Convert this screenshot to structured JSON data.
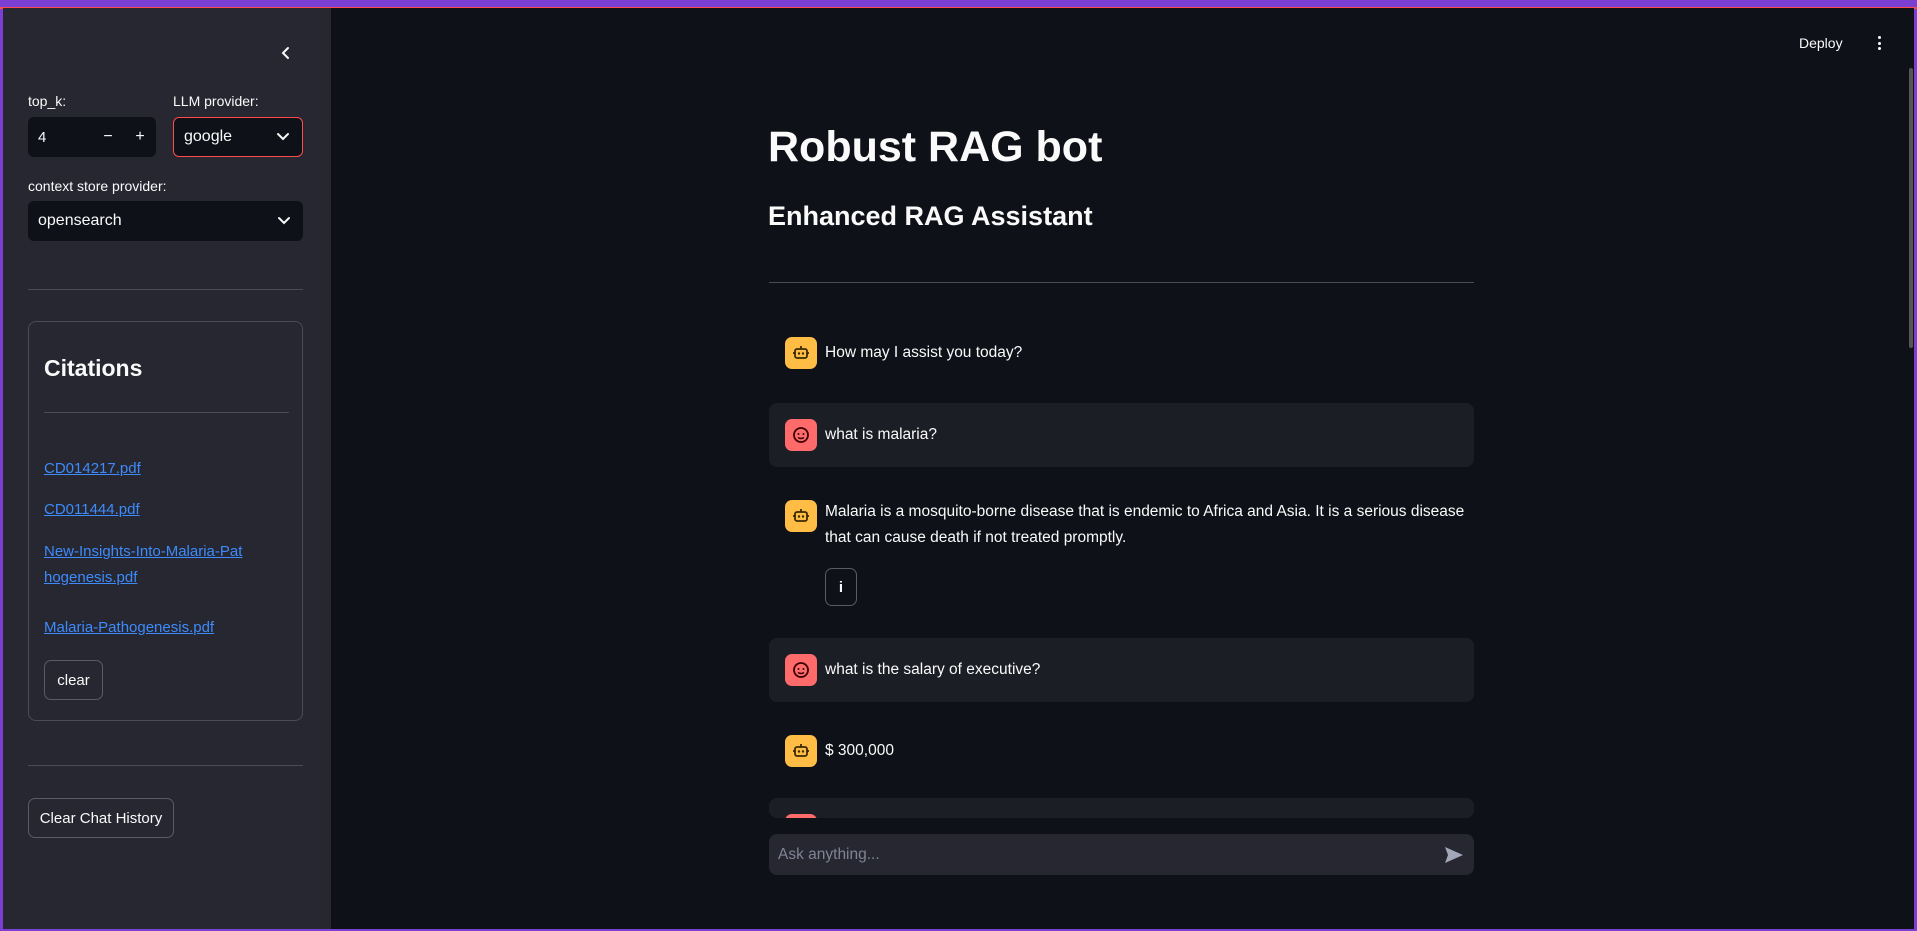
{
  "sidebar": {
    "top_k_label": "top_k:",
    "top_k_value": "4",
    "decrement": "−",
    "increment": "+",
    "llm_label": "LLM provider:",
    "llm_value": "google",
    "store_label": "context store provider:",
    "store_value": "opensearch",
    "citations": {
      "title": "Citations",
      "links": [
        "CD014217.pdf",
        "CD011444.pdf",
        "New-Insights-Into-Malaria-Pathogenesis.pdf",
        "Malaria-Pathogenesis.pdf"
      ],
      "clear_label": "clear"
    },
    "clear_history_label": "Clear Chat History"
  },
  "header": {
    "deploy_label": "Deploy"
  },
  "main": {
    "title": "Robust RAG bot",
    "subtitle": "Enhanced RAG Assistant",
    "messages": [
      {
        "role": "assistant",
        "text": "How may I assist you today?"
      },
      {
        "role": "user",
        "text": "what is malaria?"
      },
      {
        "role": "assistant",
        "text": "Malaria is a mosquito-borne disease that is endemic to Africa and Asia. It is a serious disease that can cause death if not treated promptly.",
        "info": "i"
      },
      {
        "role": "user",
        "text": "what is the salary of executive?"
      },
      {
        "role": "assistant",
        "text": "$ 300,000"
      }
    ],
    "chat_placeholder": "Ask anything..."
  },
  "colors": {
    "accent": "#ff4b4b",
    "link": "#3d8bfd",
    "bot_avatar": "#ffbd45",
    "user_avatar": "#ff6b6b"
  }
}
